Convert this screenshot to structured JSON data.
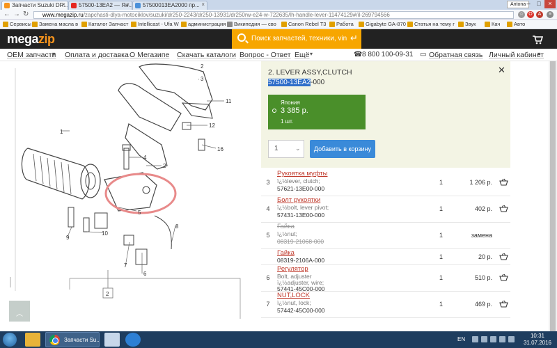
{
  "browser": {
    "tabs": [
      {
        "title": "Запчасти Suzuki DR...",
        "color": "#f7941d",
        "active": true
      },
      {
        "title": "57500-13EA2 — Ян...",
        "color": "#e52620",
        "active": false
      },
      {
        "title": "57500013EA2000 пр...",
        "color": "#4a90d9",
        "active": false
      }
    ],
    "user_badge": "Antona",
    "url_host": "www.megazip.ru",
    "url_path": "/zapchasti-dlya-motociklov/suzuki/dr250-2243/dr250-13931/dr250rw-e24-w-722635/lh-handle-lever-11474129#/il-269794566",
    "bookmarks": [
      "Сервисы",
      "Замена масла в",
      "Каталог Запчаст",
      "Intellicast - Ufa W",
      "администрация",
      "Википедия — сво",
      "Canon Rebel T3",
      "Работа",
      "Gigabyte GA-870",
      "Статья на тему г",
      "Звук",
      "Кач",
      "Авто"
    ]
  },
  "site": {
    "logo_main": "mega",
    "logo_accent": "zip",
    "search_placeholder": "Поиск запчастей, техники, vin",
    "search_enter": "↵",
    "menu": [
      "ОЕМ запчасти",
      "Оплата и доставка",
      "О Мегазипе",
      "Скачать каталоги",
      "Вопрос - Ответ",
      "Ещё"
    ],
    "phone": "8 800 100-09-31",
    "feedback": "Обратная связь",
    "cabinet": "Личный кабинет"
  },
  "diagram": {
    "labels": [
      "1",
      "2",
      "3",
      "4",
      "5",
      "6",
      "7",
      "8",
      "9",
      "10",
      "11",
      "12",
      "16",
      "9",
      "10",
      "2"
    ],
    "box_label": "2"
  },
  "detail": {
    "title": "2. LEVER ASSY,CLUTCH",
    "code_highlight": "57500-13EA2",
    "code_rest": "-000",
    "close": "✕",
    "offer_country": "Япония",
    "offer_price": "3 385 р.",
    "offer_qty": "1 шт.",
    "qty_value": "1",
    "qty_chevron": "⌄",
    "add_to_cart": "Добавить в корзину"
  },
  "parts": [
    {
      "num": "3",
      "name": "Рукоятка муфты",
      "desc": "ï¿½lever, clutch;",
      "code": "57621-13E00-000",
      "qty": "1",
      "price": "1 206 р.",
      "struck": false
    },
    {
      "num": "4",
      "name": "Болт рукоятки",
      "desc": "ï¿½bolt, lever pivot;",
      "code": "57431-13E00-000",
      "qty": "1",
      "price": "402 р.",
      "struck": false
    },
    {
      "num": "5",
      "name": "Гайка",
      "desc": "ï¿½nut;",
      "code": "08319-21068-000",
      "qty": "1",
      "price": "замена",
      "struck": true
    },
    {
      "num": "",
      "name": "Гайка",
      "desc": "",
      "code": "08319-2106A-000",
      "qty": "1",
      "price": "20 р.",
      "struck": false
    },
    {
      "num": "6",
      "name": "Регулятор",
      "desc": "Bolt, adjuster",
      "desc2": "ï¿½adjuster, wire;",
      "code": "57441-45C00-000",
      "qty": "1",
      "price": "510 р.",
      "struck": false
    },
    {
      "num": "7",
      "name": "NUT,LOCK",
      "desc": "ï¿½nut, lock;",
      "code": "57442-45C00-000",
      "qty": "1",
      "price": "469 р.",
      "struck": false
    }
  ],
  "taskbar": {
    "chrome_title": "Запчасти Su...",
    "lang": "EN",
    "time": "10:31",
    "date": "31.07.2016"
  },
  "colors": {
    "header_bg": "#222222",
    "search_bg": "#f7a600",
    "offer_bg": "#4a8f2a",
    "add_btn": "#3a8ad9",
    "link_red": "#c0392b",
    "highlight_circle": "#e88a8a"
  }
}
